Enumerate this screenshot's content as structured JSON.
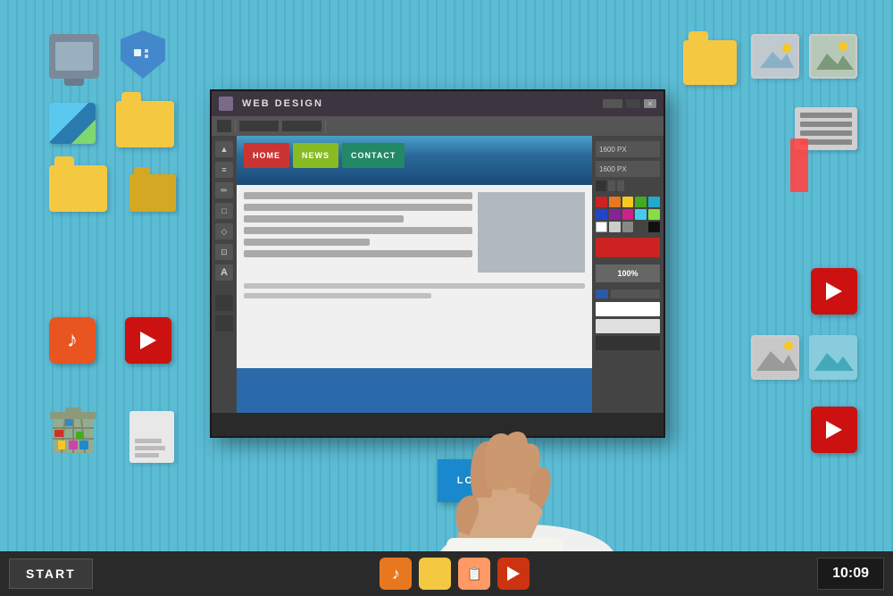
{
  "background": {
    "color": "#5bbcd4"
  },
  "taskbar": {
    "start_label": "START",
    "time": "10:09",
    "icons": [
      {
        "name": "music",
        "color": "#e87820",
        "symbol": "♪"
      },
      {
        "name": "folder",
        "color": "#f5c842",
        "symbol": "📁"
      },
      {
        "name": "note",
        "color": "#ff9966",
        "symbol": "📋"
      },
      {
        "name": "play",
        "color": "#dd4422",
        "symbol": "▶"
      }
    ]
  },
  "window": {
    "title": "WEB DESIGN",
    "canvas_size_w": "1600 PX",
    "canvas_size_h": "1600 PX",
    "zoom": "100%",
    "nav_items": [
      {
        "label": "HOME",
        "color": "#cc3333"
      },
      {
        "label": "NEWS",
        "color": "#88bb22"
      },
      {
        "label": "CONTACT",
        "color": "#228866"
      }
    ],
    "logo_label": "LOGO"
  },
  "desktop_icons_left": [
    {
      "name": "monitor",
      "type": "monitor"
    },
    {
      "name": "shield",
      "type": "shield",
      "color": "#4488cc"
    },
    {
      "name": "photo-blue",
      "type": "image",
      "color": "#5bc8f0"
    },
    {
      "name": "folder1",
      "type": "folder",
      "color": "#f5c842"
    },
    {
      "name": "folder2",
      "type": "folder",
      "color": "#f5c842"
    },
    {
      "name": "folder3",
      "type": "folder",
      "color": "#f5c842"
    },
    {
      "name": "music",
      "type": "music",
      "color": "#e85520"
    },
    {
      "name": "youtube",
      "type": "youtube",
      "color": "#cc1111"
    },
    {
      "name": "trash",
      "type": "trash"
    }
  ],
  "desktop_icons_right": [
    {
      "name": "folder-top-right",
      "type": "folder",
      "color": "#f5c842"
    },
    {
      "name": "photo-r1",
      "type": "image"
    },
    {
      "name": "photo-r2",
      "type": "image"
    },
    {
      "name": "doc-right",
      "type": "document"
    },
    {
      "name": "youtube-r",
      "type": "youtube",
      "color": "#cc1111"
    },
    {
      "name": "photo-r3",
      "type": "image"
    },
    {
      "name": "photo-r4",
      "type": "image"
    },
    {
      "name": "youtube-r2",
      "type": "youtube",
      "color": "#cc1111"
    }
  ],
  "colors": {
    "accent_blue": "#2a6aaa",
    "nav_red": "#cc3333",
    "nav_green_light": "#88bb22",
    "nav_green_dark": "#228866",
    "logo_blue": "#1a88cc",
    "taskbar_bg": "#2a2a2a"
  }
}
